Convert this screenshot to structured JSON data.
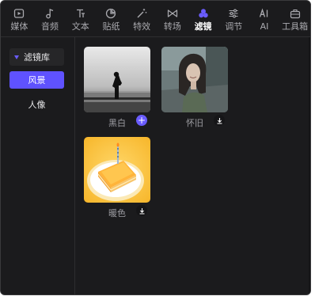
{
  "toolbar": {
    "tabs": [
      {
        "label": "媒体",
        "icon": "media-icon"
      },
      {
        "label": "音频",
        "icon": "music-note-icon"
      },
      {
        "label": "文本",
        "icon": "text-icon"
      },
      {
        "label": "贴纸",
        "icon": "sticker-icon"
      },
      {
        "label": "特效",
        "icon": "magic-wand-icon"
      },
      {
        "label": "转场",
        "icon": "transition-icon"
      },
      {
        "label": "滤镜",
        "icon": "filter-icon",
        "active": true
      },
      {
        "label": "调节",
        "icon": "sliders-icon"
      },
      {
        "label": "AI",
        "icon": "ai-icon"
      },
      {
        "label": "工具箱",
        "icon": "toolbox-icon"
      }
    ]
  },
  "sidebar": {
    "category": "滤镜库",
    "items": [
      {
        "label": "风景",
        "selected": true
      },
      {
        "label": "人像",
        "selected": false
      }
    ]
  },
  "filters": [
    {
      "label": "黑白",
      "action": "add-icon"
    },
    {
      "label": "怀旧",
      "action": "download-icon"
    },
    {
      "label": "暖色",
      "action": "download-icon"
    }
  ],
  "colors": {
    "accent": "#5f52ff",
    "panel_bg": "#1b1b1d"
  }
}
